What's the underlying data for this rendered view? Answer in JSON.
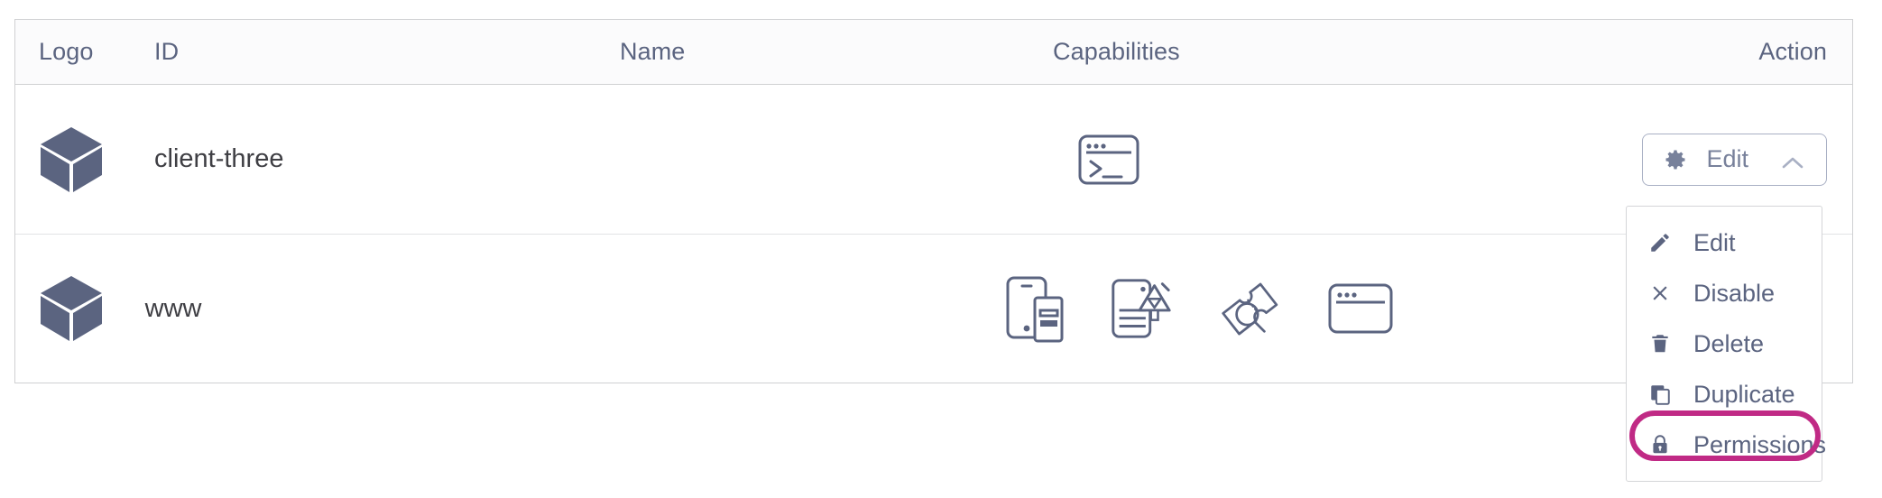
{
  "table": {
    "columns": [
      {
        "key": "logo",
        "label": "Logo"
      },
      {
        "key": "id",
        "label": "ID"
      },
      {
        "key": "name",
        "label": "Name"
      },
      {
        "key": "capabilities",
        "label": "Capabilities"
      },
      {
        "key": "action",
        "label": "Action"
      }
    ],
    "rows": [
      {
        "logo_icon": "cube-icon",
        "id": "client-three",
        "name": "",
        "capabilities": [
          "terminal-icon"
        ],
        "action_label": "Edit"
      },
      {
        "logo_icon": "cube-icon",
        "id": "www",
        "name": "",
        "capabilities": [
          "mobile-device-icon",
          "document-design-icon",
          "ticket-search-icon",
          "browser-window-icon"
        ],
        "action_label": ""
      }
    ]
  },
  "action_button": {
    "label": "Edit",
    "gear_icon": "gear-icon",
    "chevron_icon": "chevron-up-icon",
    "expanded": true
  },
  "dropdown": {
    "items": [
      {
        "label": "Edit",
        "icon": "pencil-icon"
      },
      {
        "label": "Disable",
        "icon": "close-x-icon"
      },
      {
        "label": "Delete",
        "icon": "trash-icon"
      },
      {
        "label": "Duplicate",
        "icon": "copy-icon"
      },
      {
        "label": "Permissions",
        "icon": "lock-icon"
      }
    ],
    "highlighted_item": "Permissions"
  },
  "colors": {
    "highlight": "#c02a85",
    "icon": "#5b6480",
    "text": "#3f3f44",
    "header_text": "#5b6480",
    "border": "#cfd0d2",
    "header_bg": "#fbfbfc"
  }
}
